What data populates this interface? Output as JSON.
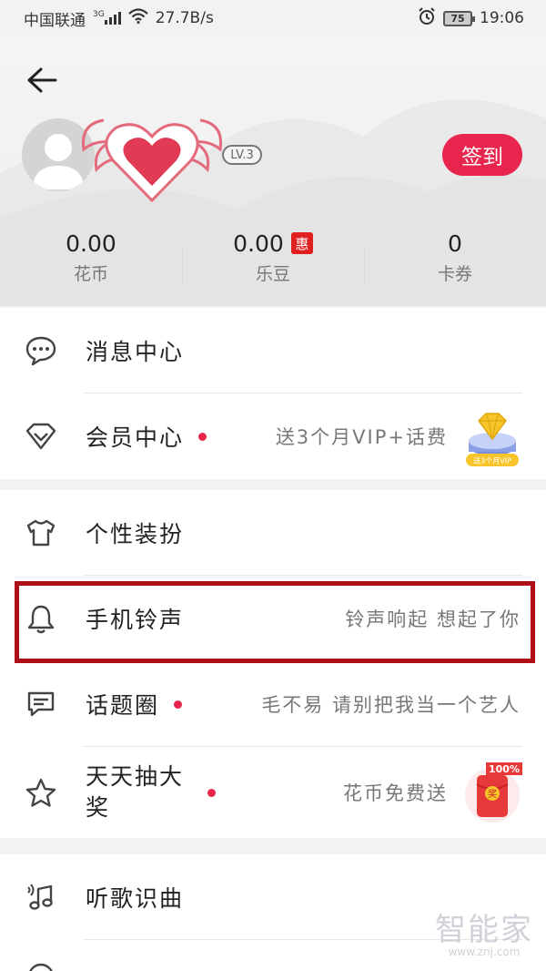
{
  "status_bar": {
    "carrier": "中国联通",
    "network": "3G",
    "speed": "27.7B/s",
    "battery": "75",
    "time": "19:06"
  },
  "header": {
    "level": "LV.3",
    "signin_label": "签到"
  },
  "stats": [
    {
      "value": "0.00",
      "label": "花币",
      "badge": ""
    },
    {
      "value": "0.00",
      "label": "乐豆",
      "badge": "惠"
    },
    {
      "value": "0",
      "label": "卡券",
      "badge": ""
    }
  ],
  "section1": [
    {
      "icon": "message-icon",
      "title": "消息中心",
      "subtitle": ""
    },
    {
      "icon": "diamond-icon",
      "title": "会员中心",
      "subtitle": "送3个月VIP+话费",
      "thumb_text": "送3个月VIP"
    }
  ],
  "section2": [
    {
      "icon": "tshirt-icon",
      "title": "个性装扮",
      "subtitle": ""
    },
    {
      "icon": "bell-icon",
      "title": "手机铃声",
      "subtitle": "铃声响起 想起了你"
    },
    {
      "icon": "chat-icon",
      "title": "话题圈",
      "subtitle": "毛不易 请别把我当一个艺人"
    },
    {
      "icon": "star-icon",
      "title": "天天抽大",
      "title2": "奖",
      "subtitle": "花币免费送",
      "thumb_text": "100%",
      "thumb_char": "奖"
    }
  ],
  "section3": [
    {
      "icon": "music-recognize-icon",
      "title": "听歌识曲"
    }
  ],
  "watermark": {
    "big": "智能家",
    "small": "www.znj.com"
  },
  "colors": {
    "accent": "#e8254d",
    "highlight": "#b10f17"
  }
}
